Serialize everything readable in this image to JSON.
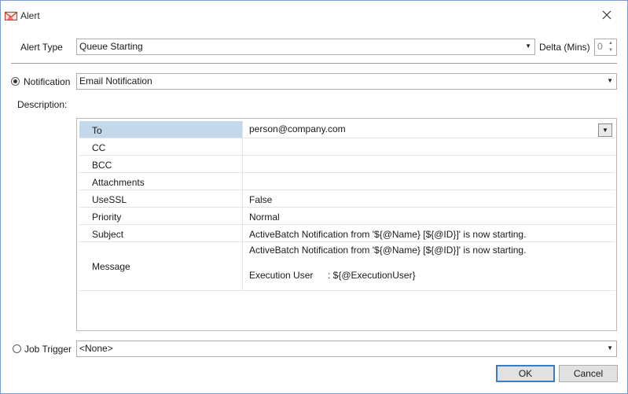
{
  "window": {
    "title": "Alert"
  },
  "alert_type": {
    "label": "Alert Type",
    "value": "Queue Starting"
  },
  "delta": {
    "label": "Delta (Mins)",
    "value": "0"
  },
  "notification": {
    "label": "Notification",
    "value": "Email Notification",
    "selected": true
  },
  "description": {
    "label": "Description:"
  },
  "properties": [
    {
      "key": "To",
      "value": "person@company.com"
    },
    {
      "key": "CC",
      "value": ""
    },
    {
      "key": "BCC",
      "value": ""
    },
    {
      "key": "Attachments",
      "value": ""
    },
    {
      "key": "UseSSL",
      "value": "False"
    },
    {
      "key": "Priority",
      "value": "Normal"
    },
    {
      "key": "Subject",
      "value": "ActiveBatch Notification from '${@Name} [${@ID}]' is now starting."
    },
    {
      "key": "Message",
      "value": "ActiveBatch Notification from  '${@Name} [${@ID}]' is now starting.",
      "value2_label": "Execution User",
      "value2_text": ": ${@ExecutionUser}"
    }
  ],
  "job_trigger": {
    "label": "Job Trigger",
    "value": "<None>",
    "selected": false
  },
  "buttons": {
    "ok": "OK",
    "cancel": "Cancel"
  },
  "colors": {
    "selection": "#c4d8ec",
    "accent": "#3d7bc4"
  }
}
